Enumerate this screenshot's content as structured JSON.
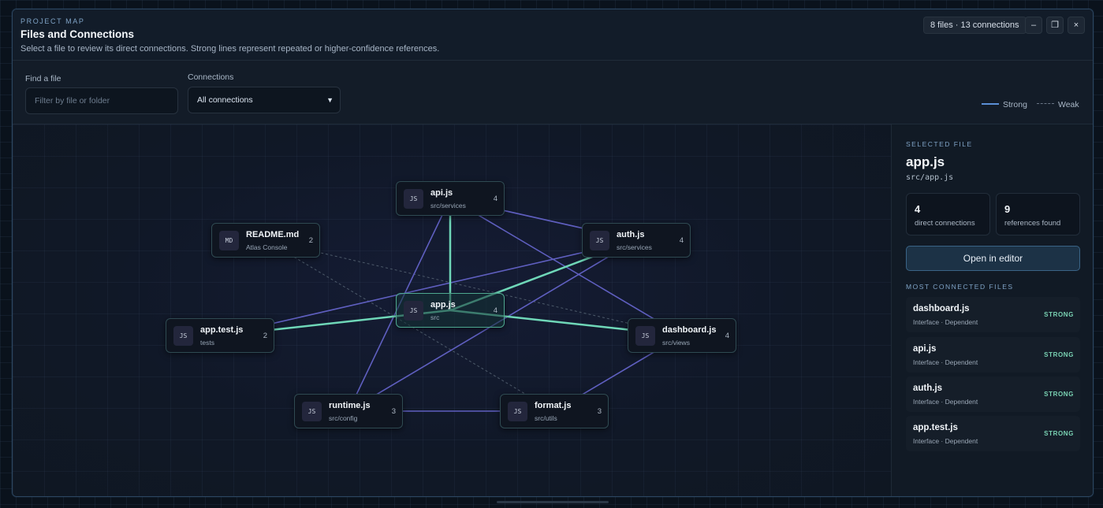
{
  "header": {
    "eyebrow": "PROJECT MAP",
    "title": "Files and Connections",
    "subtitle": "Select a file to review its direct connections. Strong lines represent repeated or higher-confidence references.",
    "counter": "8 files · 13 connections",
    "minimize": "–",
    "maximize": "❐",
    "close": "×"
  },
  "toolbar": {
    "find_label": "Find a file",
    "find_placeholder": "Filter by file or folder",
    "connections_label": "Connections",
    "connections_value": "All connections",
    "legend_strong": "Strong",
    "legend_weak": "Weak"
  },
  "nodes": [
    {
      "id": "api",
      "name": "api.js",
      "path": "src/services",
      "badge": "JS",
      "count": "4"
    },
    {
      "id": "readme",
      "name": "README.md",
      "path": "Atlas Console",
      "badge": "MD",
      "count": "2"
    },
    {
      "id": "auth",
      "name": "auth.js",
      "path": "src/services",
      "badge": "JS",
      "count": "4"
    },
    {
      "id": "app",
      "name": "app.js",
      "path": "src",
      "badge": "JS",
      "count": "4"
    },
    {
      "id": "apptest",
      "name": "app.test.js",
      "path": "tests",
      "badge": "JS",
      "count": "2"
    },
    {
      "id": "dashboard",
      "name": "dashboard.js",
      "path": "src/views",
      "badge": "JS",
      "count": "4"
    },
    {
      "id": "runtime",
      "name": "runtime.js",
      "path": "src/config",
      "badge": "JS",
      "count": "3"
    },
    {
      "id": "format",
      "name": "format.js",
      "path": "src/utils",
      "badge": "JS",
      "count": "3"
    }
  ],
  "edges": [
    {
      "from": "app",
      "to": "api",
      "kind": "selected"
    },
    {
      "from": "app",
      "to": "auth",
      "kind": "selected"
    },
    {
      "from": "app",
      "to": "apptest",
      "kind": "selected"
    },
    {
      "from": "app",
      "to": "dashboard",
      "kind": "selected"
    },
    {
      "from": "api",
      "to": "auth",
      "kind": "strong"
    },
    {
      "from": "api",
      "to": "dashboard",
      "kind": "strong"
    },
    {
      "from": "api",
      "to": "runtime",
      "kind": "strong"
    },
    {
      "from": "auth",
      "to": "apptest",
      "kind": "strong"
    },
    {
      "from": "auth",
      "to": "runtime",
      "kind": "strong"
    },
    {
      "from": "runtime",
      "to": "format",
      "kind": "strong"
    },
    {
      "from": "format",
      "to": "dashboard",
      "kind": "strong"
    },
    {
      "from": "readme",
      "to": "dashboard",
      "kind": "weak"
    },
    {
      "from": "readme",
      "to": "format",
      "kind": "weak"
    }
  ],
  "colors": {
    "selected_edge": "#6fd7b8",
    "strong_edge": "#5f5fc0",
    "weak_edge": "#4d5a6a",
    "legend_strong": "#5b8fd6",
    "accent": "#7fa3c6"
  },
  "panel": {
    "eyebrow": "SELECTED FILE",
    "name": "app.js",
    "path": "src/app.js",
    "stats": [
      {
        "value": "4",
        "label": "direct connections"
      },
      {
        "value": "9",
        "label": "references found"
      }
    ],
    "open_button": "Open in editor",
    "most_connected_label": "MOST CONNECTED FILES",
    "most_connected": [
      {
        "name": "dashboard.js",
        "sub": "Interface · Dependent",
        "tag": "STRONG"
      },
      {
        "name": "api.js",
        "sub": "Interface · Dependent",
        "tag": "STRONG"
      },
      {
        "name": "auth.js",
        "sub": "Interface · Dependent",
        "tag": "STRONG"
      },
      {
        "name": "app.test.js",
        "sub": "Interface · Dependent",
        "tag": "STRONG"
      }
    ]
  }
}
